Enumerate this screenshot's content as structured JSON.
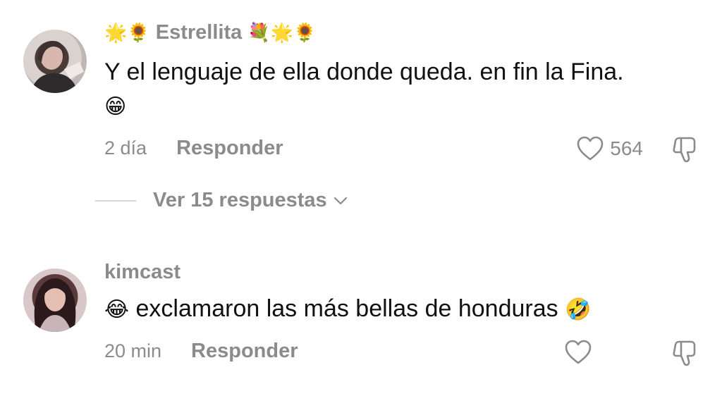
{
  "comments": [
    {
      "username": "Estrellita",
      "username_prefix": "🌟🌻",
      "username_suffix": "💐🌟🌻",
      "text_line1": "Y el lenguaje de ella donde queda. en fin la Fina.",
      "text_line2_emoji": "😁",
      "time": "2 día",
      "reply_label": "Responder",
      "likes": "564"
    },
    {
      "username": "kimcast",
      "text_prefix_emoji": "😂",
      "text": "exclamaron las más bellas de honduras",
      "text_suffix_emoji": "🤣",
      "time": "20 min",
      "reply_label": "Responder",
      "likes": ""
    }
  ],
  "replies_toggle": {
    "label": "Ver 15 respuestas"
  },
  "icons": [
    "heart-icon",
    "dislike-icon",
    "chevron-down-icon"
  ],
  "colors": {
    "muted": "#8b8b8b",
    "text": "#111111",
    "divider": "#d6d6d6"
  }
}
